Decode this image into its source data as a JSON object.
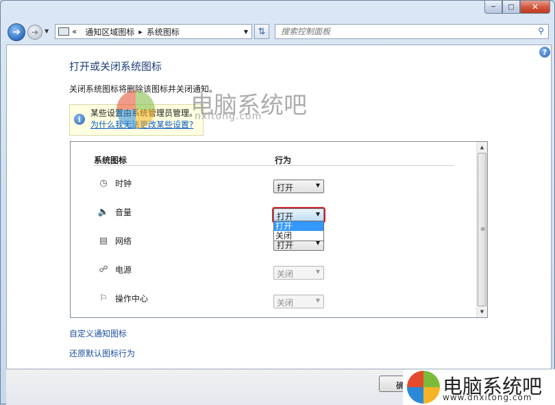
{
  "window": {
    "minimize_icon": "minimize-icon",
    "maximize_icon": "maximize-icon",
    "close_icon": "close-icon"
  },
  "nav": {
    "breadcrumb": [
      "通知区域图标",
      "系统图标"
    ],
    "search_placeholder": "搜索控制面板"
  },
  "main": {
    "title": "打开或关闭系统图标",
    "description": "关闭系统图标将删除该图标并关闭通知。",
    "notice": {
      "line1": "某些设置由系统管理员管理。",
      "link": "为什么我无法更改某些设置?"
    },
    "table": {
      "col_icon": "系统图标",
      "col_behavior": "行为",
      "rows": [
        {
          "label": "时钟",
          "icon": "clock-icon",
          "value": "打开",
          "disabled": false
        },
        {
          "label": "音量",
          "icon": "speaker-icon",
          "value": "打开",
          "disabled": false
        },
        {
          "label": "网络",
          "icon": "network-icon",
          "value": "打开",
          "disabled": false
        },
        {
          "label": "电源",
          "icon": "power-icon",
          "value": "关闭",
          "disabled": true
        },
        {
          "label": "操作中心",
          "icon": "flag-icon",
          "value": "关闭",
          "disabled": true
        }
      ],
      "dropdown_options": [
        "打开",
        "关闭"
      ]
    },
    "links": {
      "customize": "自定义通知图标",
      "restore": "还原默认图标行为"
    }
  },
  "footer": {
    "ok_label": "确"
  },
  "watermark": {
    "title": "电脑系统吧",
    "url": "www.dnxitong.com",
    "url_partial": "nxitong.com"
  }
}
